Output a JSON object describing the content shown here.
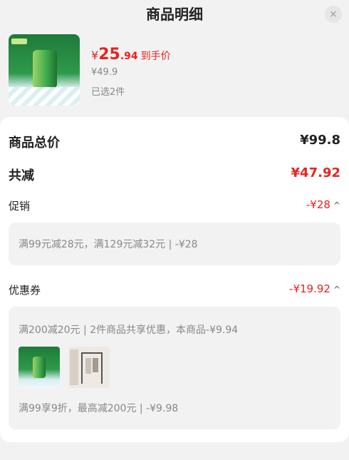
{
  "header": {
    "title": "商品明细",
    "close": "×"
  },
  "product": {
    "price_yen": "¥",
    "price_int": "25",
    "price_dec": ".94",
    "price_tag": "到手价",
    "original_price": "¥49.9",
    "selected": "已选2件",
    "image_icon": "soda-can-image"
  },
  "summary": {
    "total_label": "商品总价",
    "total_value": "¥99.8",
    "reduce_label": "共减",
    "reduce_value": "¥47.92"
  },
  "promotion": {
    "label": "促销",
    "value": "-¥28",
    "caret": "^",
    "detail": "满99元减28元，满129元减32元 | -¥28"
  },
  "coupon": {
    "label": "优惠券",
    "value": "-¥19.92",
    "caret": "^",
    "detail1": "满200减20元 | 2件商品共享优惠，本商品-¥9.94",
    "detail2": "满99享9折，最高减200元 | -¥9.98",
    "thumbs": [
      "soda-drink-thumbnail",
      "clothes-rack-thumbnail"
    ]
  },
  "colors": {
    "accent": "#e8231e",
    "muted": "#888888",
    "bg": "#f2f2f2"
  }
}
